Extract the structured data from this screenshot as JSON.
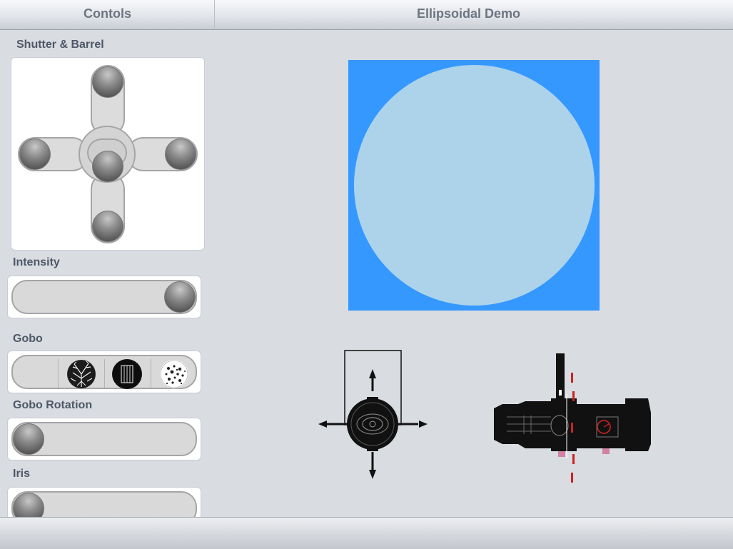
{
  "header": {
    "left_title": "Contols",
    "right_title": "Ellipsoidal Demo"
  },
  "controls": {
    "shutter_barrel": {
      "label": "Shutter & Barrel"
    },
    "intensity": {
      "label": "Intensity",
      "value": 1.0
    },
    "gobo": {
      "label": "Gobo",
      "options": [
        "none-gobo",
        "branches-gobo",
        "window-gobo",
        "breakup-gobo"
      ],
      "selected": "window-gobo"
    },
    "gobo_rotation": {
      "label": "Gobo Rotation",
      "value": 0.0
    },
    "iris": {
      "label": "Iris",
      "value": 0.0
    }
  },
  "beam": {
    "field_color": "#3598fe",
    "spot_color": "#acd3ea"
  },
  "fixture_views": {
    "front": {
      "icon": "ellipsoidal-front-view-icon"
    },
    "side": {
      "icon": "ellipsoidal-side-view-icon"
    }
  }
}
